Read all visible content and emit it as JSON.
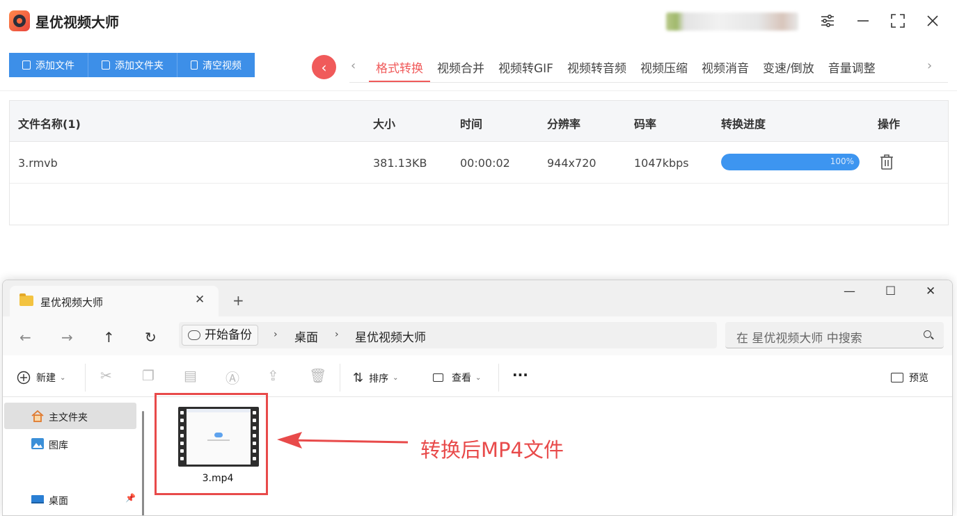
{
  "app": {
    "title": "星优视频大师"
  },
  "toolbar": {
    "add_file": "添加文件",
    "add_folder": "添加文件夹",
    "clear_videos": "清空视频"
  },
  "tabs": [
    {
      "label": "格式转换",
      "active": true
    },
    {
      "label": "视频合并",
      "active": false
    },
    {
      "label": "视频转GIF",
      "active": false
    },
    {
      "label": "视频转音频",
      "active": false
    },
    {
      "label": "视频压缩",
      "active": false
    },
    {
      "label": "视频消音",
      "active": false
    },
    {
      "label": "变速/倒放",
      "active": false
    },
    {
      "label": "音量调整",
      "active": false
    }
  ],
  "table": {
    "headers": {
      "name": "文件名称(1)",
      "size": "大小",
      "time": "时间",
      "resolution": "分辨率",
      "bitrate": "码率",
      "progress": "转换进度",
      "action": "操作"
    },
    "rows": [
      {
        "name": "3.rmvb",
        "size": "381.13KB",
        "time": "00:00:02",
        "resolution": "944x720",
        "bitrate": "1047kbps",
        "progress_label": "100%",
        "progress_value": 1.0
      }
    ]
  },
  "explorer": {
    "tab_title": "星优视频大师",
    "address": {
      "root": "开始备份",
      "parts": [
        "桌面",
        "星优视频大师"
      ]
    },
    "search_placeholder": "在 星优视频大师 中搜索",
    "commands": {
      "new": "新建",
      "sort": "排序",
      "view": "查看",
      "more": "···",
      "preview": "预览"
    },
    "sidebar": [
      {
        "label": "主文件夹",
        "selected": true
      },
      {
        "label": "图库",
        "selected": false
      },
      {
        "label": "桌面",
        "selected": false
      }
    ],
    "files": [
      {
        "name": "3.mp4"
      }
    ]
  },
  "annotation": {
    "text": "转换后MP4文件"
  },
  "colors": {
    "primary_blue": "#3d8fe8",
    "accent_red": "#f05a5a",
    "progress_blue": "#3d95f0",
    "annotation_red": "#e84a4a"
  }
}
